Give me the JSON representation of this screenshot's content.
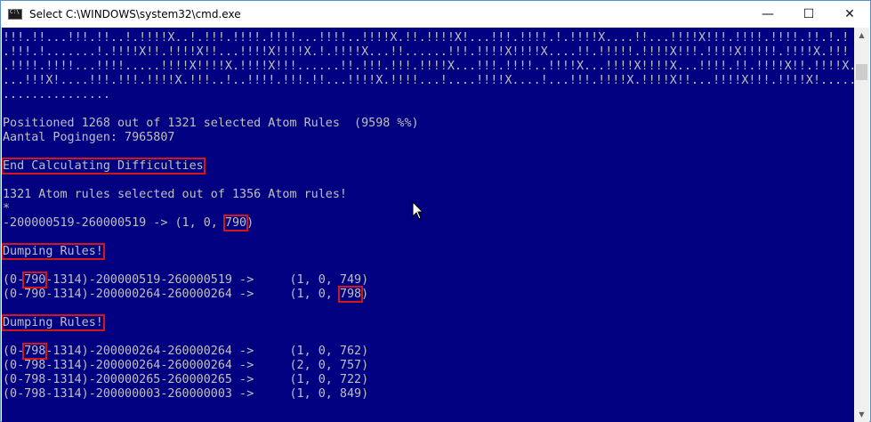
{
  "window": {
    "title": "Select C:\\WINDOWS\\system32\\cmd.exe",
    "icon": "cmd-icon",
    "controls": {
      "minimize": "—",
      "maximize": "☐",
      "close": "✕"
    }
  },
  "console": {
    "bg_color": "#000080",
    "text_color": "#c0c0c0",
    "highlight_color": "#d4141e",
    "lines": [
      "!!!.!!...!!!.!!..!.!!!!X..!.!!!.!!!!.!!!!...!!!!..!!!!X.!!.!!!!X!...!!!.!!!!.!.!!!!X....!!...!!!!X!!!.!!!!.!!!!.!!.!.!",
      ".!!!.!.......!.!!!!X!!.!!!!X!!...!!!!X!!!!X.!.!!!!X...!!......!!!.!!!!X!!!!X....!!.!!!!!.!!!!X!!!.!!!!X!!!!!.!!!!X.!!!",
      ".!!!!.!!!!...!!!!.....!!!!X!!!!X.!!!!X!!!......!!.!!!.!!!.!!!!X...!!!.!!!!..!!!!X...!!!!X!!!!X...!!!!.!!.!!!!X!!.!!!!X..!!!!.!!!",
      "...!!!X!....!!!.!!!.!!!!X.!!!..!..!!!!.!!!.!!...!!!!X.!!!!...!....!!!!X....!...!!!.!!!!X.!!!!X!!...!!!!X!!!.!!!!X!.......",
      "...............",
      "",
      "Positioned 1268 out of 1321 selected Atom Rules  (9598 %%)",
      "Aantal Pogingen: 7965807",
      "",
      "End Calculating Difficulties",
      "",
      "1321 Atom rules selected out of 1356 Atom rules!",
      "*",
      "-200000519-260000519 -> (1, 0, 790)",
      "",
      "Dumping Rules!",
      "",
      "(0-790-1314)-200000519-260000519 ->     (1, 0, 749)",
      "(0-790-1314)-200000264-260000264 ->     (1, 0, 798)",
      "",
      "Dumping Rules!",
      "",
      "(0-798-1314)-200000264-260000264 ->     (1, 0, 762)",
      "(0-798-1314)-200000264-260000264 ->     (2, 0, 757)",
      "(0-798-1314)-200000265-260000265 ->     (1, 0, 722)",
      "(0-798-1314)-200000003-260000003 ->     (1, 0, 849)"
    ],
    "highlighted": [
      {
        "line": 9,
        "text": "End Calculating Difficulties"
      },
      {
        "line": 13,
        "text": "790"
      },
      {
        "line": 15,
        "text": "Dumping Rules!"
      },
      {
        "line": 17,
        "text": "790"
      },
      {
        "line": 18,
        "text": "798"
      },
      {
        "line": 20,
        "text": "Dumping Rules!"
      },
      {
        "line": 22,
        "text": "798"
      }
    ]
  },
  "scrollbar": {
    "up_icon": "scroll-up-arrow-icon",
    "down_icon": "scroll-down-arrow-icon"
  },
  "cursor": {
    "icon": "mouse-pointer-icon"
  }
}
